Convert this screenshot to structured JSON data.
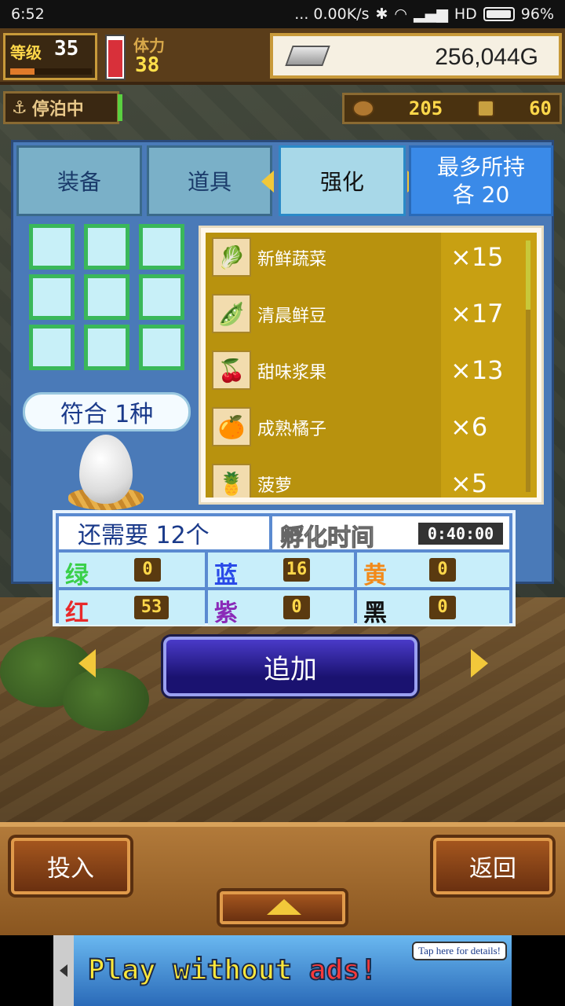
{
  "status_bar": {
    "time": "6:52",
    "network": "... 0.00K/s",
    "carrier": "HD",
    "battery": "96%"
  },
  "hud": {
    "level_label": "等级",
    "level": "35",
    "level_progress": 0.3,
    "stamina_label": "体力",
    "stamina": "38",
    "stamina_gauge": 0.95,
    "gold": "256,044G",
    "port_status": "停泊中",
    "resource_1": "205",
    "resource_2": "60"
  },
  "tabs": [
    {
      "label": "装备"
    },
    {
      "label": "道具"
    },
    {
      "label": "强化"
    }
  ],
  "max_hold": {
    "line1": "最多所持",
    "line2": "各 20"
  },
  "match_label": "符合 1种",
  "items": [
    {
      "name": "新鲜蔬菜",
      "count": "×15",
      "icon": "vegetable-icon"
    },
    {
      "name": "清晨鲜豆",
      "count": "×17",
      "icon": "bean-icon"
    },
    {
      "name": "甜味浆果",
      "count": "×13",
      "icon": "berry-icon"
    },
    {
      "name": "成熟橘子",
      "count": "×6",
      "icon": "orange-icon"
    },
    {
      "name": "菠萝",
      "count": "×5",
      "icon": "pineapple-icon"
    }
  ],
  "hatch": {
    "need_label": "还需要 12个",
    "time_label": "孵化时间",
    "time_value": "0:40:00"
  },
  "colors_stats": [
    {
      "label": "绿",
      "value": "0",
      "color": "#3ad04a"
    },
    {
      "label": "蓝",
      "value": "16",
      "color": "#2a4ae8"
    },
    {
      "label": "黄",
      "value": "0",
      "color": "#f28a1a"
    },
    {
      "label": "红",
      "value": "53",
      "color": "#e82a2a"
    },
    {
      "label": "紫",
      "value": "0",
      "color": "#8a2ab8"
    },
    {
      "label": "黑",
      "value": "0",
      "color": "#111111"
    }
  ],
  "add_button": "追加",
  "bottom": {
    "left_button": "投入",
    "right_button": "返回"
  },
  "ad": {
    "text_main": "Play without ",
    "text_red": "ads!",
    "tip": "Tap here for details!"
  }
}
